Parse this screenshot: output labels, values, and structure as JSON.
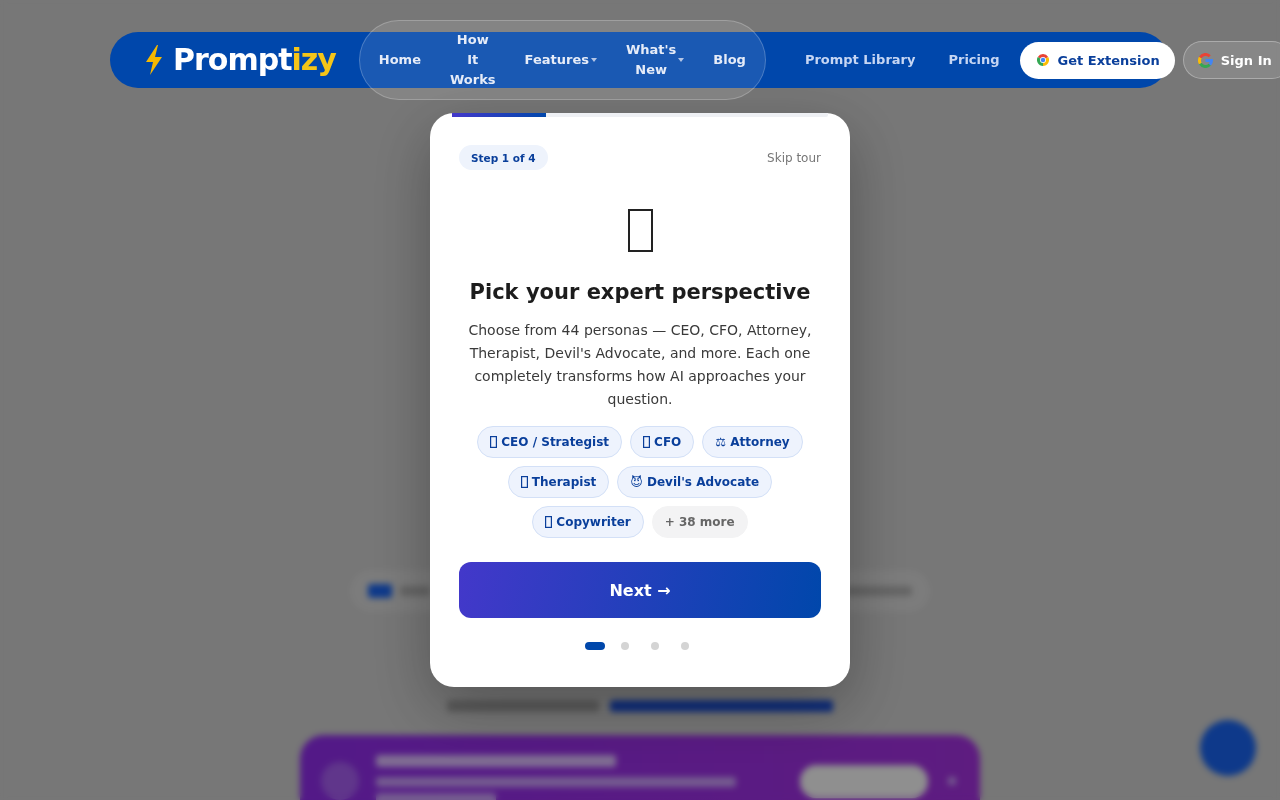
{
  "header": {
    "logo": {
      "text": "Prompt",
      "accent": "izy"
    },
    "nav": [
      {
        "label": "Home",
        "dropdown": false
      },
      {
        "label": "How It Works",
        "dropdown": false
      },
      {
        "label": "Features",
        "dropdown": true
      },
      {
        "label": "What's New",
        "dropdown": true
      },
      {
        "label": "Blog",
        "dropdown": false
      }
    ],
    "links": [
      "Prompt Library",
      "Pricing"
    ],
    "extension_button": "Get Extension",
    "sign_in_button": "Sign In"
  },
  "tour": {
    "progress": {
      "level": 0.25
    },
    "step": "Step 1 of 4",
    "skip": "Skip tour",
    "title": "Pick your expert perspective",
    "description": "Choose from 44 personas — CEO, CFO, Attorney, Therapist, Devil's Advocate, and more. Each one completely transforms how AI approaches your question.",
    "personas": [
      {
        "label": "CEO / Strategist",
        "kind": "boxed"
      },
      {
        "label": "CFO",
        "kind": "boxed"
      },
      {
        "label": "⚖ Attorney",
        "kind": "plain"
      },
      {
        "label": "Therapist",
        "kind": "boxed"
      },
      {
        "label": "😈 Devil's Advocate",
        "kind": "plain"
      },
      {
        "label": "Copywriter",
        "kind": "boxed"
      },
      {
        "label": "+ 38 more",
        "kind": "more"
      }
    ],
    "next_button": "Next →",
    "dots": [
      {
        "selected": true
      },
      {
        "selected": false
      },
      {
        "selected": false
      },
      {
        "selected": false
      }
    ]
  }
}
